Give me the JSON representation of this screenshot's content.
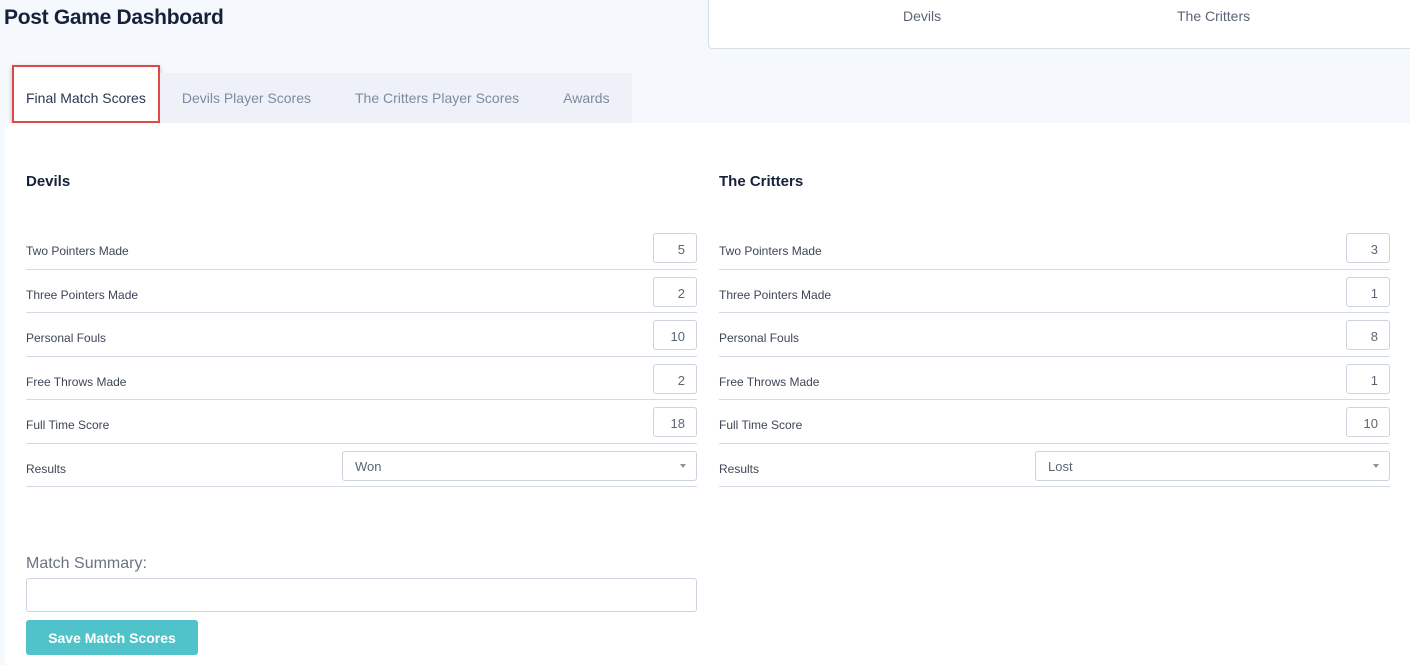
{
  "header": {
    "title": "Post Game Dashboard",
    "teams": [
      "Devils",
      "The Critters"
    ]
  },
  "tabs": [
    {
      "label": "Final Match Scores"
    },
    {
      "label": "Devils Player Scores"
    },
    {
      "label": "The Critters Player Scores"
    },
    {
      "label": "Awards"
    }
  ],
  "teams": [
    {
      "name": "Devils",
      "stats": [
        {
          "label": "Two Pointers Made",
          "value": "5"
        },
        {
          "label": "Three Pointers Made",
          "value": "2"
        },
        {
          "label": "Personal Fouls",
          "value": "10"
        },
        {
          "label": "Free Throws Made",
          "value": "2"
        },
        {
          "label": "Full Time Score",
          "value": "18"
        }
      ],
      "results_label": "Results",
      "result": "Won"
    },
    {
      "name": "The Critters",
      "stats": [
        {
          "label": "Two Pointers Made",
          "value": "3"
        },
        {
          "label": "Three Pointers Made",
          "value": "1"
        },
        {
          "label": "Personal Fouls",
          "value": "8"
        },
        {
          "label": "Free Throws Made",
          "value": "1"
        },
        {
          "label": "Full Time Score",
          "value": "10"
        }
      ],
      "results_label": "Results",
      "result": "Lost"
    }
  ],
  "summary": {
    "label": "Match Summary:",
    "value": ""
  },
  "save_label": "Save Match Scores"
}
